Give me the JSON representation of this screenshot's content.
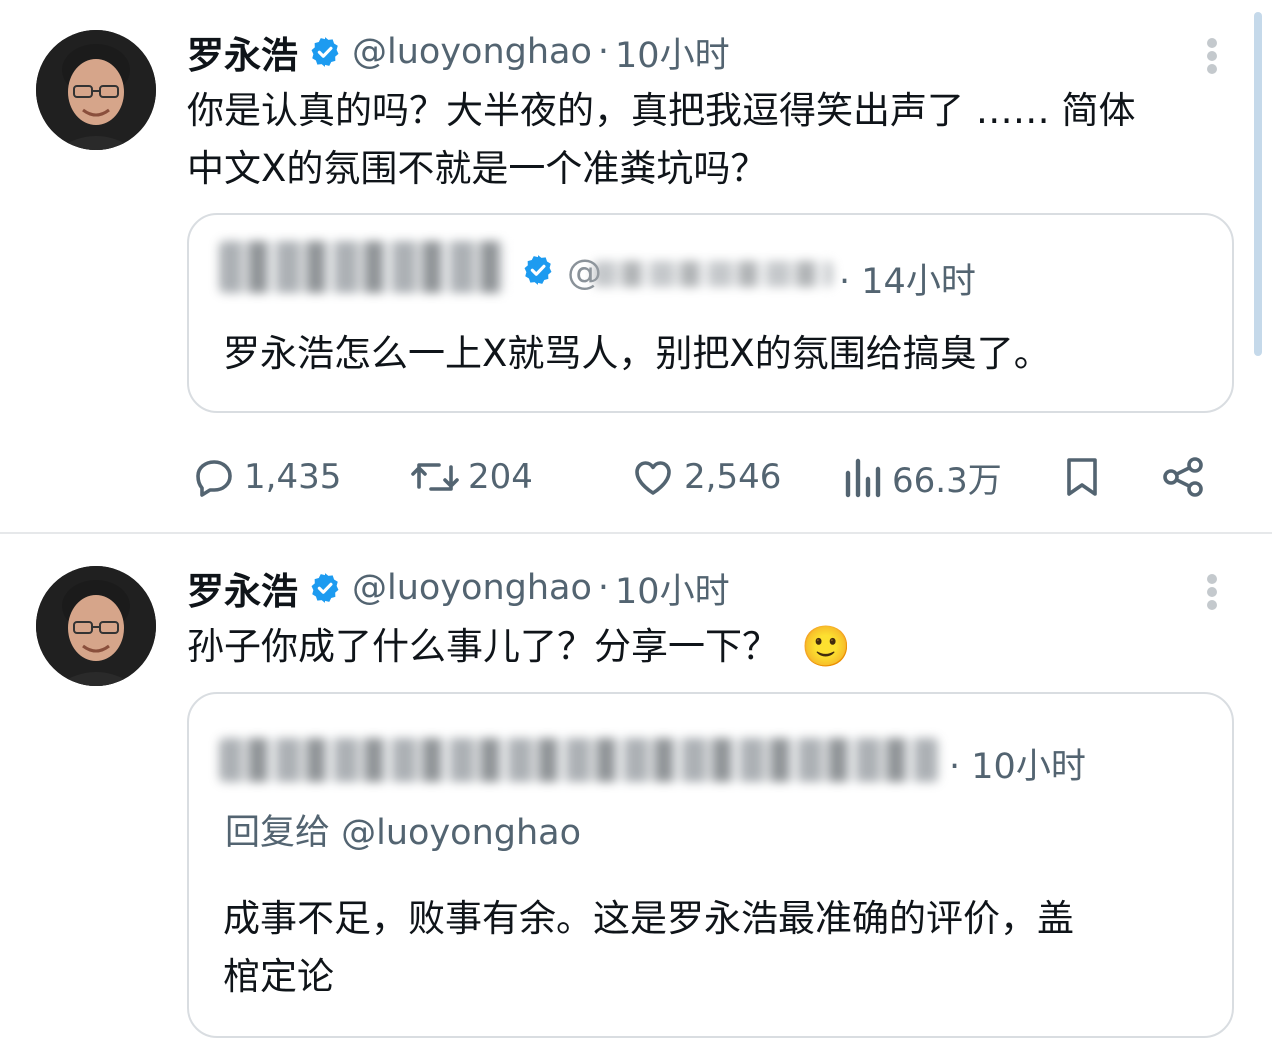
{
  "tweets": [
    {
      "author_name": "罗永浩",
      "handle": "@luoyonghao",
      "dot": "·",
      "time": "10小时",
      "text_lines": [
        "你是认真的吗？大半夜的，真把我逗得笑出声了 …… 简体",
        "中文X的氛围不就是一个准粪坑吗？"
      ],
      "quote": {
        "handle_prefix": "@",
        "dot": "·",
        "time": "14小时",
        "text": "罗永浩怎么一上X就骂人，别把X的氛围给搞臭了。"
      },
      "actions": {
        "reply_count": "1,435",
        "retweet_count": "204",
        "like_count": "2,546",
        "view_count": "66.3万"
      }
    },
    {
      "author_name": "罗永浩",
      "handle": "@luoyonghao",
      "dot": "·",
      "time": "10小时",
      "text_lines": [
        "孙子你成了什么事儿了？分享一下？"
      ],
      "emoji": "🙂",
      "quote": {
        "dot": "·",
        "time": "10小时",
        "reply_to": "回复给 @luoyonghao",
        "text_lines": [
          "成事不足，败事有余。这是罗永浩最准确的评价，盖",
          "棺定论"
        ]
      }
    }
  ],
  "icons": {
    "verified": "verified-badge-icon",
    "more": "more-dots-icon",
    "reply": "comment-bubble-icon",
    "retweet": "retweet-arrows-icon",
    "like": "heart-icon",
    "views": "bar-chart-icon",
    "bookmark": "bookmark-icon",
    "share": "share-icon"
  },
  "colors": {
    "verified_blue": "#1d9bf0",
    "secondary_text": "#536471",
    "border": "#d9dde1"
  }
}
